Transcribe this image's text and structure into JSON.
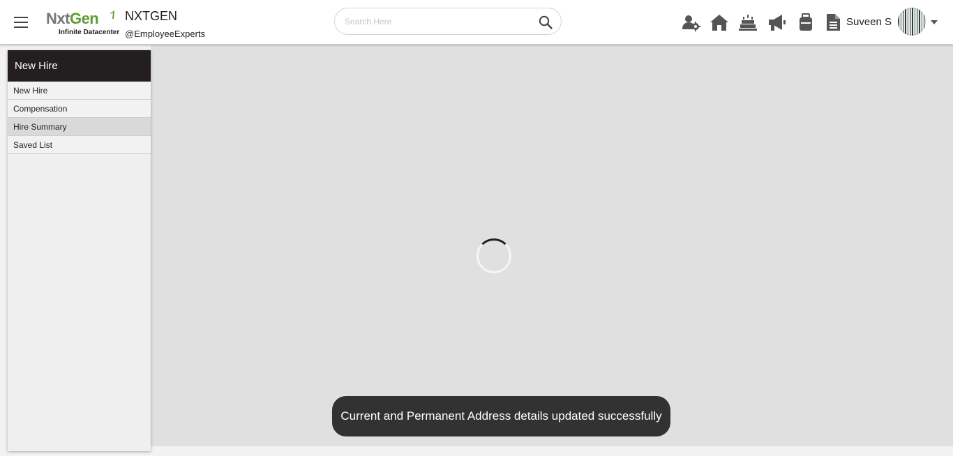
{
  "header": {
    "logo_text_nxt": "Nxt",
    "logo_text_gen": "Gen",
    "logo_subtext": "Infinite Datacenter",
    "company_name": "NXTGEN",
    "company_handle": "@EmployeeExperts",
    "search_placeholder": "Search Here",
    "search_value": "",
    "icons": [
      "team-settings-icon",
      "home-icon",
      "birthday-cake-icon",
      "megaphone-icon",
      "briefcase-icon",
      "document-icon"
    ],
    "user_name": "Suveen S"
  },
  "sidebar": {
    "title": "New Hire",
    "items": [
      {
        "label": "New Hire",
        "active": false
      },
      {
        "label": "Compensation",
        "active": false
      },
      {
        "label": "Hire Summary",
        "active": true
      },
      {
        "label": "Saved List",
        "active": false
      }
    ]
  },
  "main": {
    "loading": true
  },
  "toast": {
    "message": "Current and Permanent Address details updated successfully"
  },
  "colors": {
    "brand_green": "#5e9b2f",
    "brand_gray": "#777777",
    "sidebar_header": "#231f20",
    "toast_bg": "#323232",
    "content_bg": "#e0e0e0"
  }
}
